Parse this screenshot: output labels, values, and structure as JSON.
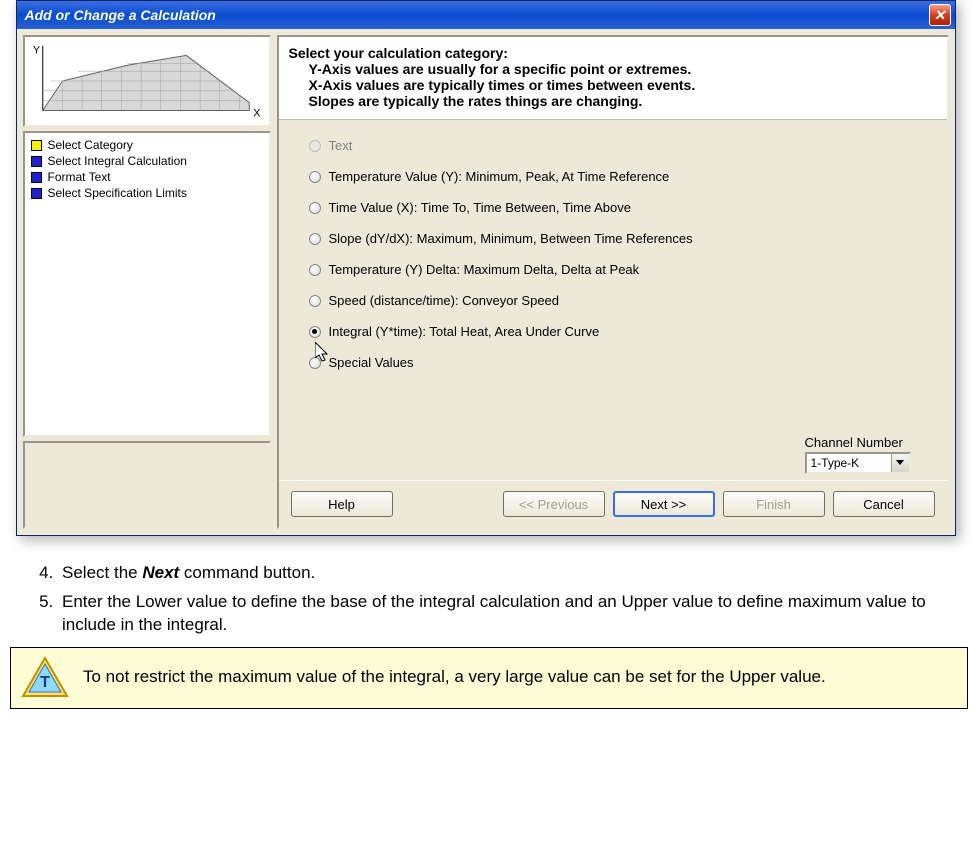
{
  "dialog": {
    "title": "Add or Change a Calculation",
    "close_label": "✕",
    "steps": [
      {
        "marker": "yellow",
        "label": "Select Category"
      },
      {
        "marker": "blue",
        "label": "Select Integral Calculation"
      },
      {
        "marker": "blue",
        "label": "Format Text"
      },
      {
        "marker": "blue",
        "label": "Select Specification Limits"
      }
    ],
    "header": {
      "line1": "Select your calculation category:",
      "line2": "Y-Axis values are usually for a specific point or extremes.",
      "line3": "X-Axis values are typically times or times between events.",
      "line4": "Slopes are typically the rates things are changing."
    },
    "options": [
      {
        "label": "Text",
        "disabled": true,
        "selected": false
      },
      {
        "label": "Temperature Value (Y):  Minimum, Peak, At Time Reference",
        "disabled": false,
        "selected": false
      },
      {
        "label": "Time Value (X):  Time To, Time Between, Time Above",
        "disabled": false,
        "selected": false
      },
      {
        "label": "Slope (dY/dX):  Maximum, Minimum, Between Time References",
        "disabled": false,
        "selected": false
      },
      {
        "label": "Temperature (Y) Delta:  Maximum Delta, Delta at Peak",
        "disabled": false,
        "selected": false
      },
      {
        "label": "Speed (distance/time): Conveyor Speed",
        "disabled": false,
        "selected": false
      },
      {
        "label": "Integral (Y*time): Total Heat, Area Under Curve",
        "disabled": false,
        "selected": true
      },
      {
        "label": "Special  Values",
        "disabled": false,
        "selected": false
      }
    ],
    "channel": {
      "label": "Channel Number",
      "value": "1-Type-K"
    },
    "buttons": {
      "help": "Help",
      "previous": "<< Previous",
      "next": "Next >>",
      "finish": "Finish",
      "cancel": "Cancel"
    },
    "axis": {
      "x": "X",
      "y": "Y"
    }
  },
  "instructions": {
    "items": [
      {
        "num": "4)",
        "text_pre": "Select the ",
        "bold": "Next",
        "text_post": " command button."
      },
      {
        "num": "5)",
        "text_pre": "Enter the Lower value to define the base of the integral calculation and an Upper value to define maximum value to include in the integral.",
        "bold": "",
        "text_post": ""
      }
    ]
  },
  "tip": {
    "text": "To not restrict the maximum value of the integral, a very large value can be set for the Upper value."
  }
}
